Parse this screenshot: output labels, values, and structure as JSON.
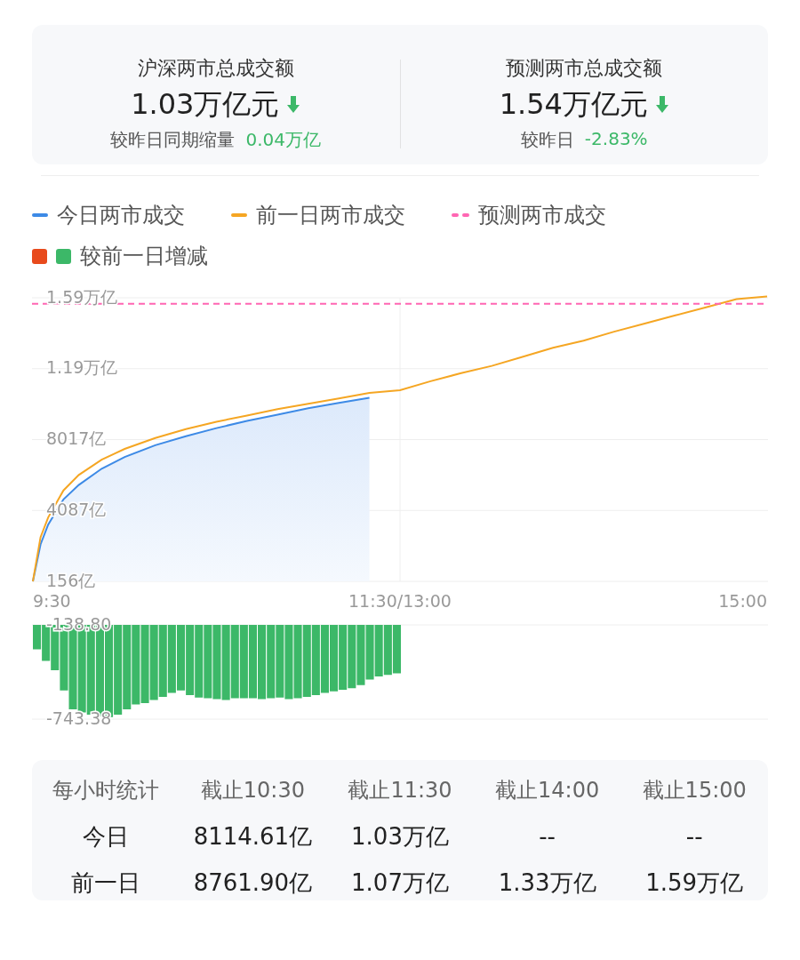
{
  "summary": [
    {
      "title": "沪深两市总成交额",
      "value": "1.03万亿元",
      "falling": true,
      "compare_label": "较昨日同期缩量",
      "compare_value": "0.04万亿"
    },
    {
      "title": "预测两市总成交额",
      "value": "1.54万亿元",
      "falling": true,
      "compare_label": "较昨日",
      "compare_value": "-2.83%"
    }
  ],
  "legend": [
    {
      "kind": "line",
      "label": "今日两市成交",
      "color": "#3d8ae6"
    },
    {
      "kind": "line",
      "label": "前一日两市成交",
      "color": "#f5a623"
    },
    {
      "kind": "dashed",
      "label": "预测两市成交",
      "color": "#ff66b3"
    },
    {
      "kind": "squares",
      "label": "较前一日增减",
      "swatches": [
        {
          "color": "#e84a1c"
        },
        {
          "color": "#3cb868"
        }
      ]
    }
  ],
  "line_chart": {
    "y_labels": [
      "1.59万亿",
      "1.19万亿",
      "8017亿",
      "4087亿",
      "156亿"
    ],
    "x_labels": [
      "9:30",
      "11:30/13:00",
      "15:00"
    ]
  },
  "bar_chart": {
    "y_labels": [
      "-138.80",
      "-743.38"
    ]
  },
  "table": {
    "columns": [
      "每小时统计",
      "截止10:30",
      "截止11:30",
      "截止14:00",
      "截止15:00"
    ],
    "rows": [
      [
        "今日",
        "8114.61亿",
        "1.03万亿",
        "--",
        "--"
      ],
      [
        "前一日",
        "8761.90亿",
        "1.07万亿",
        "1.33万亿",
        "1.59万亿"
      ]
    ]
  }
}
